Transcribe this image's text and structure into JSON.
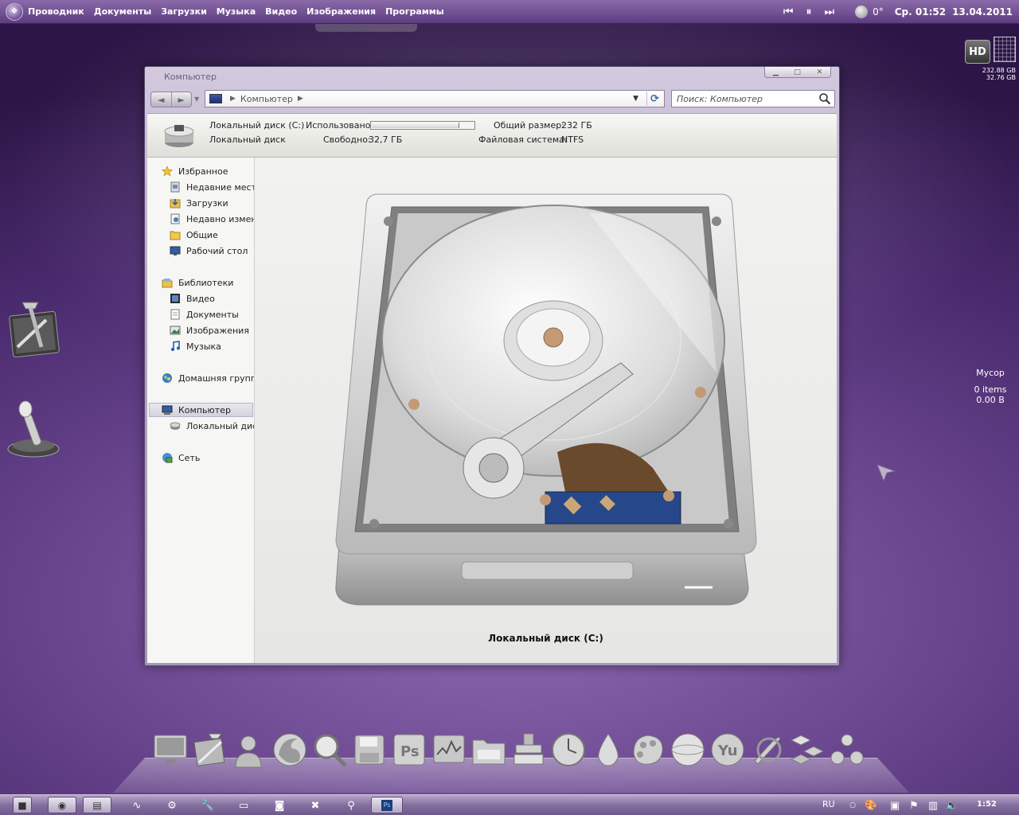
{
  "topbar": {
    "menu": [
      "Проводник",
      "Документы",
      "Загрузки",
      "Музыка",
      "Видео",
      "Изображения",
      "Программы"
    ],
    "weather_temp": "0°",
    "clock": "Ср. 01:52",
    "date": "13.04.2011"
  },
  "hd_gadget": {
    "badge": "HD",
    "total": "232.88 GB",
    "free": "32.76 GB"
  },
  "trash": {
    "name": "Мусор",
    "items": "0 items",
    "size": "0.00 B"
  },
  "window": {
    "title": "Компьютер",
    "address_crumb": "Компьютер",
    "search_placeholder": "Поиск: Компьютер",
    "details": {
      "drive_name": "Локальный диск (C:)",
      "drive_type": "Локальный диск",
      "used_label": "Использовано:",
      "used_fraction": 0.86,
      "free_label": "Свободно:",
      "free_value": "32,7 ГБ",
      "total_label": "Общий размер:",
      "total_value": "232 ГБ",
      "fs_label": "Файловая система:",
      "fs_value": "NTFS"
    },
    "nav": {
      "favorites": "Избранное",
      "recent_places": "Недавние места",
      "downloads": "Загрузки",
      "recently_changed": "Недавно изменен",
      "shared": "Общие",
      "desktop": "Рабочий стол",
      "libraries": "Библиотеки",
      "video": "Видео",
      "documents": "Документы",
      "images": "Изображения",
      "music": "Музыка",
      "homegroup": "Домашняя группа",
      "computer": "Компьютер",
      "local_disk": "Локальный диск",
      "network": "Сеть"
    },
    "content_caption": "Локальный диск (C:)"
  },
  "taskbar": {
    "lang": "RU",
    "time": "1:52"
  },
  "colors": {
    "desktop_purple": "#5a3680",
    "window_frame": "#b6a8c9",
    "accent_blue": "#3b6aa0"
  }
}
